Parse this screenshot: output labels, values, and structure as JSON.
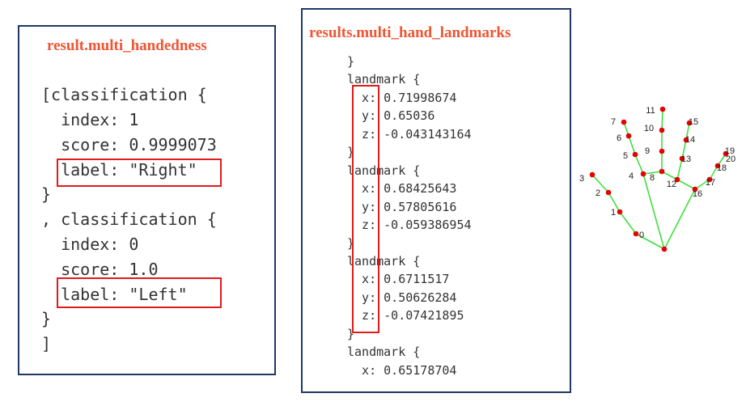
{
  "left_panel": {
    "title": "result.multi_handedness",
    "lines": [
      "[classification {",
      "  index: 1",
      "  score: 0.9999073",
      "  label: \"Right\"",
      "}",
      ", classification {",
      "  index: 0",
      "  score: 1.0",
      "  label: \"Left\"",
      "}",
      "]"
    ]
  },
  "mid_panel": {
    "title": "results.multi_hand_landmarks",
    "lines": [
      "}",
      "landmark {",
      "  x: 0.71998674",
      "  y: 0.65036",
      "  z: -0.043143164",
      "}",
      "landmark {",
      "  x: 0.68425643",
      "  y: 0.57805616",
      "  z: -0.059386954",
      "}",
      "landmark {",
      "  x: 0.6711517",
      "  y: 0.50626284",
      "  z: -0.07421895",
      "}",
      "landmark {",
      "  x: 0.65178704"
    ]
  },
  "hand_diagram": {
    "point_color": "#e60000",
    "line_color": "#3ee03e",
    "landmark_labels": [
      "0",
      "1",
      "2",
      "3",
      "4",
      "5",
      "6",
      "7",
      "8",
      "9",
      "10",
      "11",
      "12",
      "13",
      "14",
      "15",
      "16",
      "17",
      "18",
      "19",
      "20"
    ]
  },
  "colors": {
    "title": "#ee5533",
    "highlight_box": "#e01b1b",
    "panel_border": "#1f3864"
  }
}
